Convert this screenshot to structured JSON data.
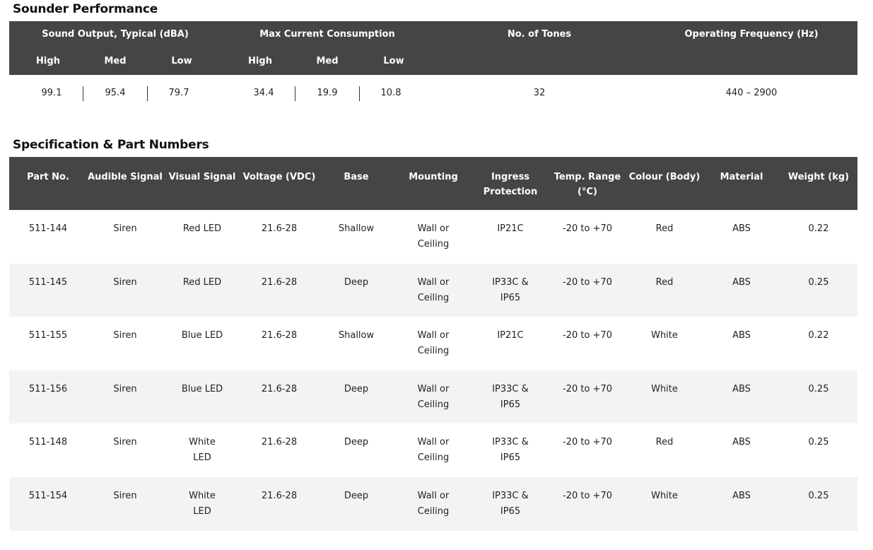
{
  "performance": {
    "title": "Sounder Performance",
    "headers": {
      "sound_output": "Sound Output, Typical (dBA)",
      "max_current": "Max Current Consumption",
      "tones": "No. of Tones",
      "frequency": "Operating Frequency (Hz)",
      "sub": [
        "High",
        "Med",
        "Low",
        "High",
        "Med",
        "Low"
      ]
    },
    "values": {
      "sound": [
        "99.1",
        "95.4",
        "79.7"
      ],
      "current": [
        "34.4",
        "19.9",
        "10.8"
      ],
      "tones": "32",
      "frequency": "440 – 2900"
    }
  },
  "spec": {
    "title": "Specification & Part Numbers",
    "columns": [
      "Part No.",
      "Audible Signal",
      "Visual Signal",
      "Voltage (VDC)",
      "Base",
      "Mounting",
      "Ingress Protection",
      "Temp. Range (°C)",
      "Colour (Body)",
      "Material",
      "Weight (kg)"
    ],
    "rows": [
      [
        "511-144",
        "Siren",
        "Red LED",
        "21.6-28",
        "Shallow",
        "Wall or Ceiling",
        "IP21C",
        "-20 to +70",
        "Red",
        "ABS",
        "0.22"
      ],
      [
        "511-145",
        "Siren",
        "Red LED",
        "21.6-28",
        "Deep",
        "Wall or Ceiling",
        "IP33C & IP65",
        "-20 to +70",
        "Red",
        "ABS",
        "0.25"
      ],
      [
        "511-155",
        "Siren",
        "Blue LED",
        "21.6-28",
        "Shallow",
        "Wall or Ceiling",
        "IP21C",
        "-20 to +70",
        "White",
        "ABS",
        "0.22"
      ],
      [
        "511-156",
        "Siren",
        "Blue LED",
        "21.6-28",
        "Deep",
        "Wall or Ceiling",
        "IP33C & IP65",
        "-20 to +70",
        "White",
        "ABS",
        "0.25"
      ],
      [
        "511-148",
        "Siren",
        "White LED",
        "21.6-28",
        "Deep",
        "Wall or Ceiling",
        "IP33C & IP65",
        "-20 to +70",
        "Red",
        "ABS",
        "0.25"
      ],
      [
        "511-154",
        "Siren",
        "White LED",
        "21.6-28",
        "Deep",
        "Wall or Ceiling",
        "IP33C & IP65",
        "-20 to +70",
        "White",
        "ABS",
        "0.25"
      ]
    ]
  }
}
